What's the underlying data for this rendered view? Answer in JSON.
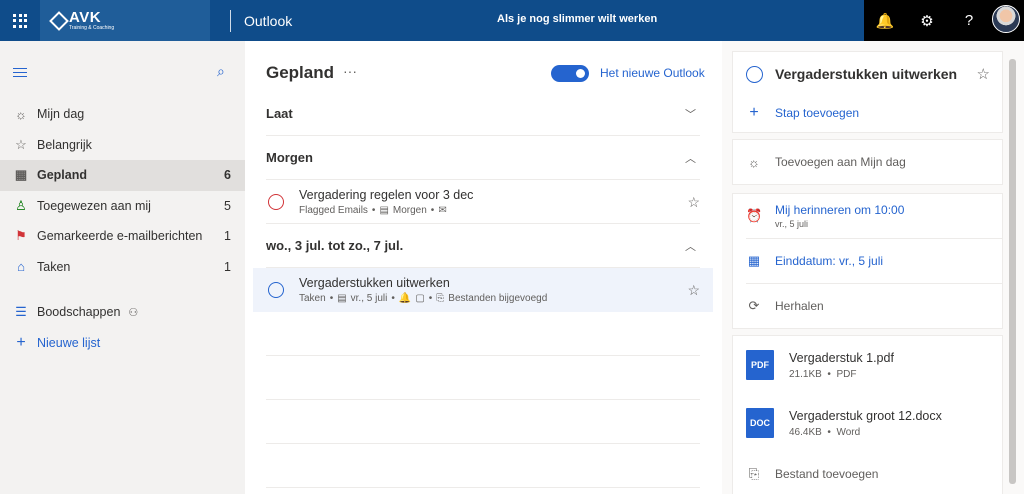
{
  "header": {
    "brand": "AVK",
    "brand_sub": "Training & Coaching",
    "app_title": "Outlook",
    "promo": "Als je nog slimmer wilt werken"
  },
  "sidebar": {
    "items": [
      {
        "label": "Mijn dag",
        "icon": "sun-icon",
        "count": ""
      },
      {
        "label": "Belangrijk",
        "icon": "star-icon",
        "count": ""
      },
      {
        "label": "Gepland",
        "icon": "calendar-icon",
        "count": "6"
      },
      {
        "label": "Toegewezen aan mij",
        "icon": "person-icon",
        "count": "5"
      },
      {
        "label": "Gemarkeerde e-mailberichten",
        "icon": "flag-icon",
        "count": "1"
      },
      {
        "label": "Taken",
        "icon": "home-icon",
        "count": "1"
      }
    ],
    "list_name": "Boodschappen",
    "new_list": "Nieuwe lijst"
  },
  "main": {
    "title": "Gepland",
    "toggle_label": "Het nieuwe Outlook",
    "groups": {
      "late": "Laat",
      "tomorrow": "Morgen",
      "week": "wo., 3 jul. tot zo., 7 jul."
    },
    "tasks": [
      {
        "title": "Vergadering regelen voor 3 dec",
        "meta_source": "Flagged Emails",
        "meta_date": "Morgen"
      },
      {
        "title": "Vergaderstukken uitwerken",
        "meta_source": "Taken",
        "meta_date": "vr., 5 juli",
        "meta_files": "Bestanden bijgevoegd"
      }
    ]
  },
  "detail": {
    "title": "Vergaderstukken uitwerken",
    "add_step": "Stap toevoegen",
    "my_day": "Toevoegen aan Mijn dag",
    "reminder": "Mij herinneren om 10:00",
    "reminder_sub": "vr., 5 juli",
    "due": "Einddatum: vr., 5 juli",
    "repeat": "Herhalen",
    "files": [
      {
        "type": "PDF",
        "name": "Vergaderstuk 1.pdf",
        "size": "21.1KB",
        "kind": "PDF"
      },
      {
        "type": "DOC",
        "name": "Vergaderstuk groot 12.docx",
        "size": "46.4KB",
        "kind": "Word"
      }
    ],
    "add_file": "Bestand toevoegen"
  },
  "colors": {
    "accent": "#2564cf",
    "header": "#0f4c8a",
    "flag": "#d13438"
  }
}
